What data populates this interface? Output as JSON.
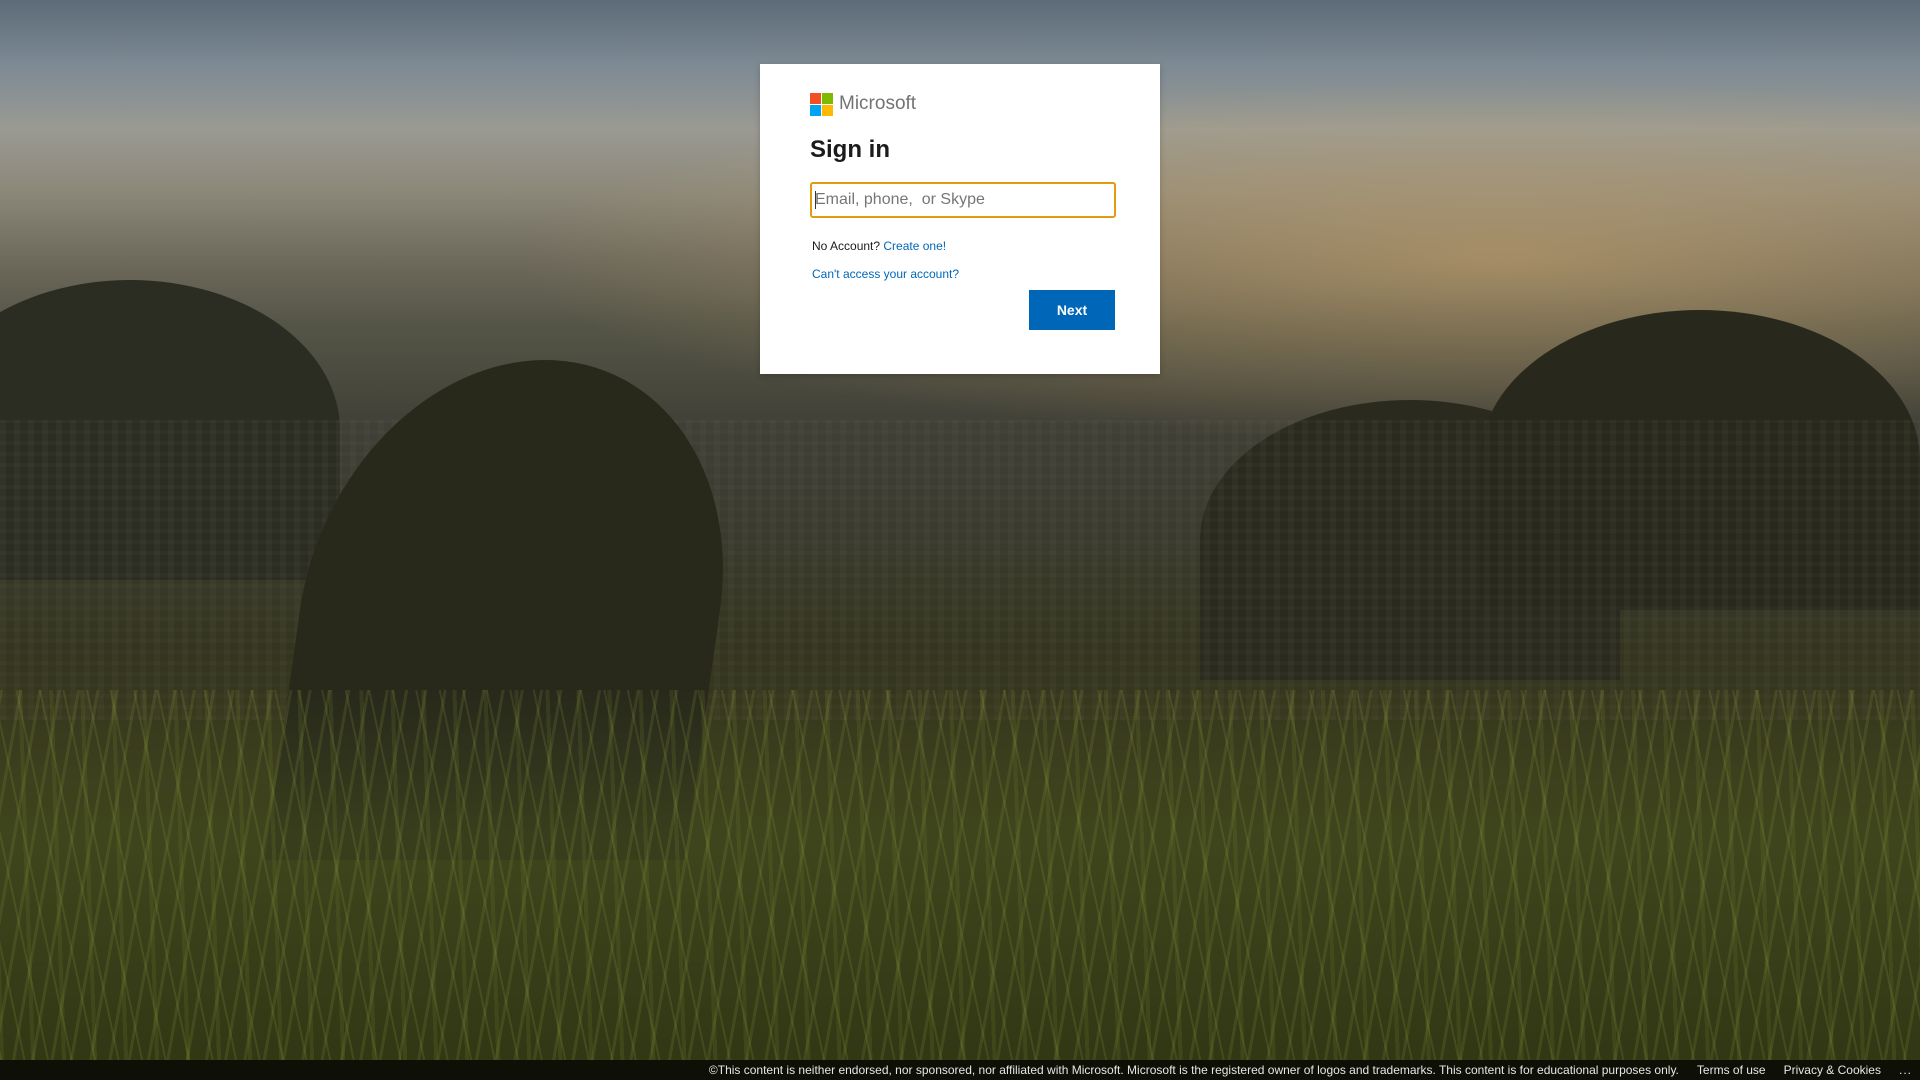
{
  "brand": {
    "name": "Microsoft",
    "logo_colors": [
      "#f25022",
      "#7fba00",
      "#00a4ef",
      "#ffb900"
    ]
  },
  "signin": {
    "title": "Sign in",
    "input_placeholder": "Email, phone,  or Skype",
    "input_value": "",
    "no_account_text": "No Account?",
    "create_link": "Create one!",
    "cant_access_link": "Can't access your account?",
    "next_label": "Next"
  },
  "footer": {
    "disclaimer": "©This content is neither endorsed, nor sponsored, nor affiliated with Microsoft. Microsoft is the registered owner of logos and trademarks. This content is for educational purposes only.",
    "terms": "Terms of use",
    "privacy": "Privacy & Cookies",
    "more": "..."
  },
  "colors": {
    "accent": "#0067b8",
    "input_focus_border": "#e19b0d",
    "card_bg": "#ffffff"
  }
}
